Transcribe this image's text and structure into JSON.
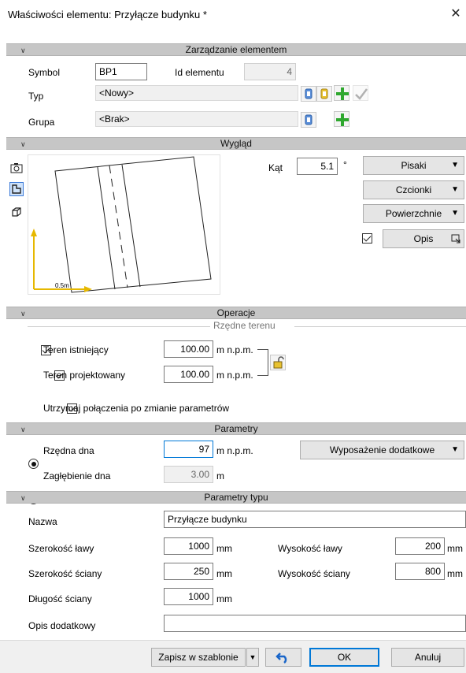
{
  "window": {
    "title": "Właściwości elementu: Przyłącze budynku *",
    "close_glyph": "✕"
  },
  "sections": {
    "management": "Zarządzanie elementem",
    "appearance": "Wygląd",
    "operations": "Operacje",
    "parameters": "Parametry",
    "type_parameters": "Parametry typu"
  },
  "management": {
    "symbol_label": "Symbol",
    "symbol_value": "BP1",
    "id_label": "Id elementu",
    "id_value": "4",
    "type_label": "Typ",
    "type_value": "<Nowy>",
    "group_label": "Grupa",
    "group_value": "<Brak>"
  },
  "appearance": {
    "angle_label": "Kąt",
    "angle_value": "5.1",
    "angle_unit": "°",
    "pens": "Pisaki",
    "fonts": "Czcionki",
    "surfaces": "Powierzchnie",
    "description": "Opis",
    "scale_label": "0.5m"
  },
  "operations": {
    "terrain_group": "Rzędne terenu",
    "existing_label": "Teren istniejący",
    "existing_value": "100.00",
    "existing_unit": "m n.p.m.",
    "designed_label": "Teren projektowany",
    "designed_value": "100.00",
    "designed_unit": "m n.p.m.",
    "keep_connections": "Utrzymaj połączenia po zmianie parametrów"
  },
  "parameters": {
    "bottom_level_label": "Rzędna dna",
    "bottom_level_value": "97",
    "bottom_level_unit": "m n.p.m.",
    "depth_label": "Zagłębienie dna",
    "depth_value": "3.00",
    "depth_unit": "m",
    "equipment": "Wyposażenie dodatkowe"
  },
  "type_parameters": {
    "name_label": "Nazwa",
    "name_value": "Przyłącze budynku",
    "bench_width_label": "Szerokość ławy",
    "bench_width_value": "1000",
    "bench_width_unit": "mm",
    "bench_height_label": "Wysokość ławy",
    "bench_height_value": "200",
    "bench_height_unit": "mm",
    "wall_width_label": "Szerokość ściany",
    "wall_width_value": "250",
    "wall_width_unit": "mm",
    "wall_height_label": "Wysokość ściany",
    "wall_height_value": "800",
    "wall_height_unit": "mm",
    "wall_length_label": "Długość ściany",
    "wall_length_value": "1000",
    "wall_length_unit": "mm",
    "extra_desc_label": "Opis dodatkowy",
    "extra_desc_value": ""
  },
  "footer": {
    "save_template": "Zapisz w szablonie",
    "ok": "OK",
    "cancel": "Anuluj"
  },
  "colors": {
    "accent": "#0078d7",
    "section_bg": "#c6c6c6",
    "plus_green": "#2fa82f",
    "axis_yellow": "#e6b800"
  }
}
